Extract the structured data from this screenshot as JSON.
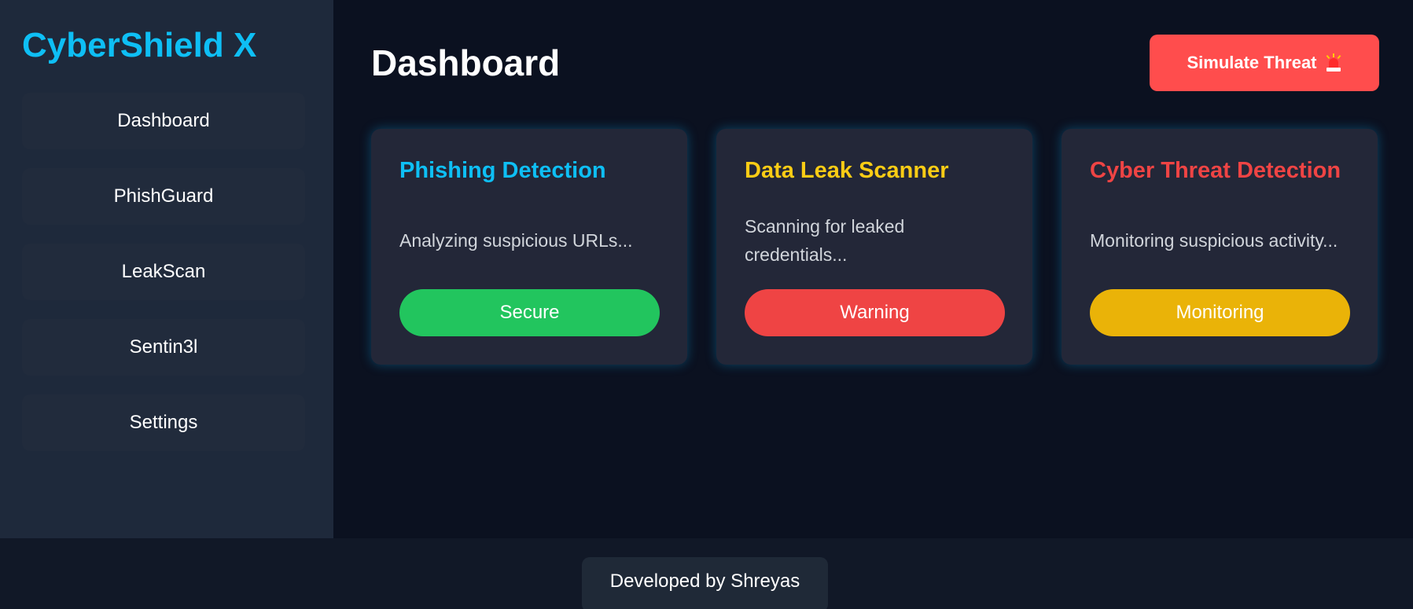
{
  "app": {
    "brand": "CyberShield X",
    "brand_color": "#0ebff5"
  },
  "sidebar": {
    "items": [
      {
        "label": "Dashboard"
      },
      {
        "label": "PhishGuard"
      },
      {
        "label": "LeakScan"
      },
      {
        "label": "Sentin3l"
      },
      {
        "label": "Settings"
      }
    ]
  },
  "header": {
    "title": "Dashboard",
    "simulate_label": "Simulate Threat",
    "simulate_icon": "siren-icon",
    "simulate_color": "#ff4d4d"
  },
  "cards": [
    {
      "title": "Phishing Detection",
      "title_color": "#0ebff5",
      "description": "Analyzing suspicious URLs...",
      "status": "Secure",
      "status_color": "#22c55e"
    },
    {
      "title": "Data Leak Scanner",
      "title_color": "#facc15",
      "description": "Scanning for leaked credentials...",
      "status": "Warning",
      "status_color": "#ef4444"
    },
    {
      "title": "Cyber Threat Detection",
      "title_color": "#ef4444",
      "description": "Monitoring suspicious activity...",
      "status": "Monitoring",
      "status_color": "#eab308"
    }
  ],
  "footer": {
    "credit": "Developed by Shreyas"
  }
}
